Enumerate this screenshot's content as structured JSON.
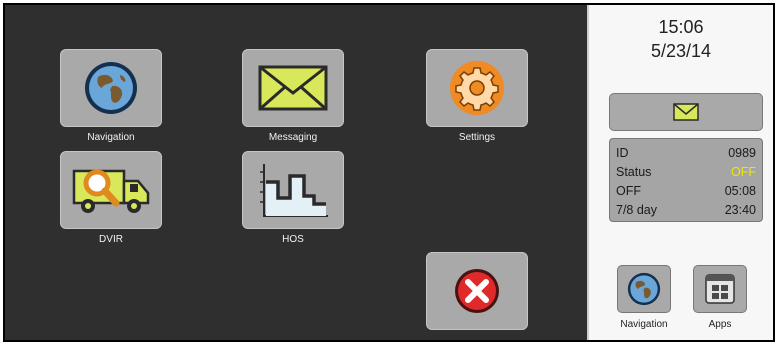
{
  "apps": [
    {
      "id": "navigation",
      "label": "Navigation",
      "icon": "globe-icon"
    },
    {
      "id": "messaging",
      "label": "Messaging",
      "icon": "envelope-icon"
    },
    {
      "id": "settings",
      "label": "Settings",
      "icon": "gear-icon"
    },
    {
      "id": "dvir",
      "label": "DVIR",
      "icon": "truck-inspection-icon"
    },
    {
      "id": "hos",
      "label": "HOS",
      "icon": "hos-graph-icon"
    }
  ],
  "close_icon": "close-icon",
  "status_panel": {
    "time": "15:06",
    "date": "5/23/14",
    "message_icon": "envelope-icon",
    "rows": [
      {
        "label": "ID",
        "value": "0989"
      },
      {
        "label": "Status",
        "value": "OFF"
      },
      {
        "label": "OFF",
        "value": "05:08"
      },
      {
        "label": "7/8 day",
        "value": "23:40"
      }
    ]
  },
  "dock": [
    {
      "label": "Navigation",
      "icon": "globe-icon"
    },
    {
      "label": "Apps",
      "icon": "apps-grid-icon"
    }
  ],
  "colors": {
    "background": "#2f2f2f",
    "tile": "#a9a9a9",
    "side_panel": "#f7f7f7",
    "status_off": "#f2e600",
    "envelope": "#d9e85a",
    "gear": "#f08a24",
    "close": "#e02a2a"
  }
}
